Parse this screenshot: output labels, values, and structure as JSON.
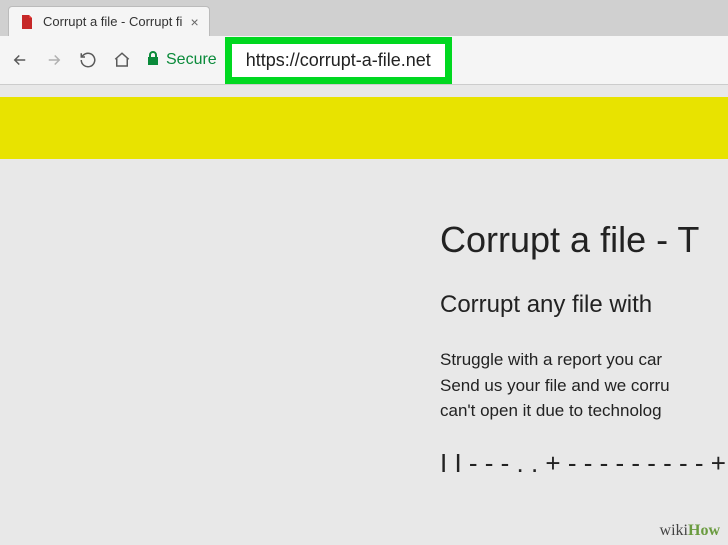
{
  "tab": {
    "title": "Corrupt a file - Corrupt fi",
    "close": "×"
  },
  "toolbar": {
    "secure_label": "Secure",
    "url": "https://corrupt-a-file.net"
  },
  "page": {
    "title": "Corrupt a file - T",
    "subtitle": "Corrupt any file with",
    "body_line1": "Struggle with a report you car",
    "body_line2": "Send us your file and we corru",
    "body_line3": "can't open it due to technolog",
    "cutoff": "I I - - - . . + - - - - - - - - - + -"
  },
  "watermark": {
    "prefix": "wiki",
    "suffix": "How"
  }
}
